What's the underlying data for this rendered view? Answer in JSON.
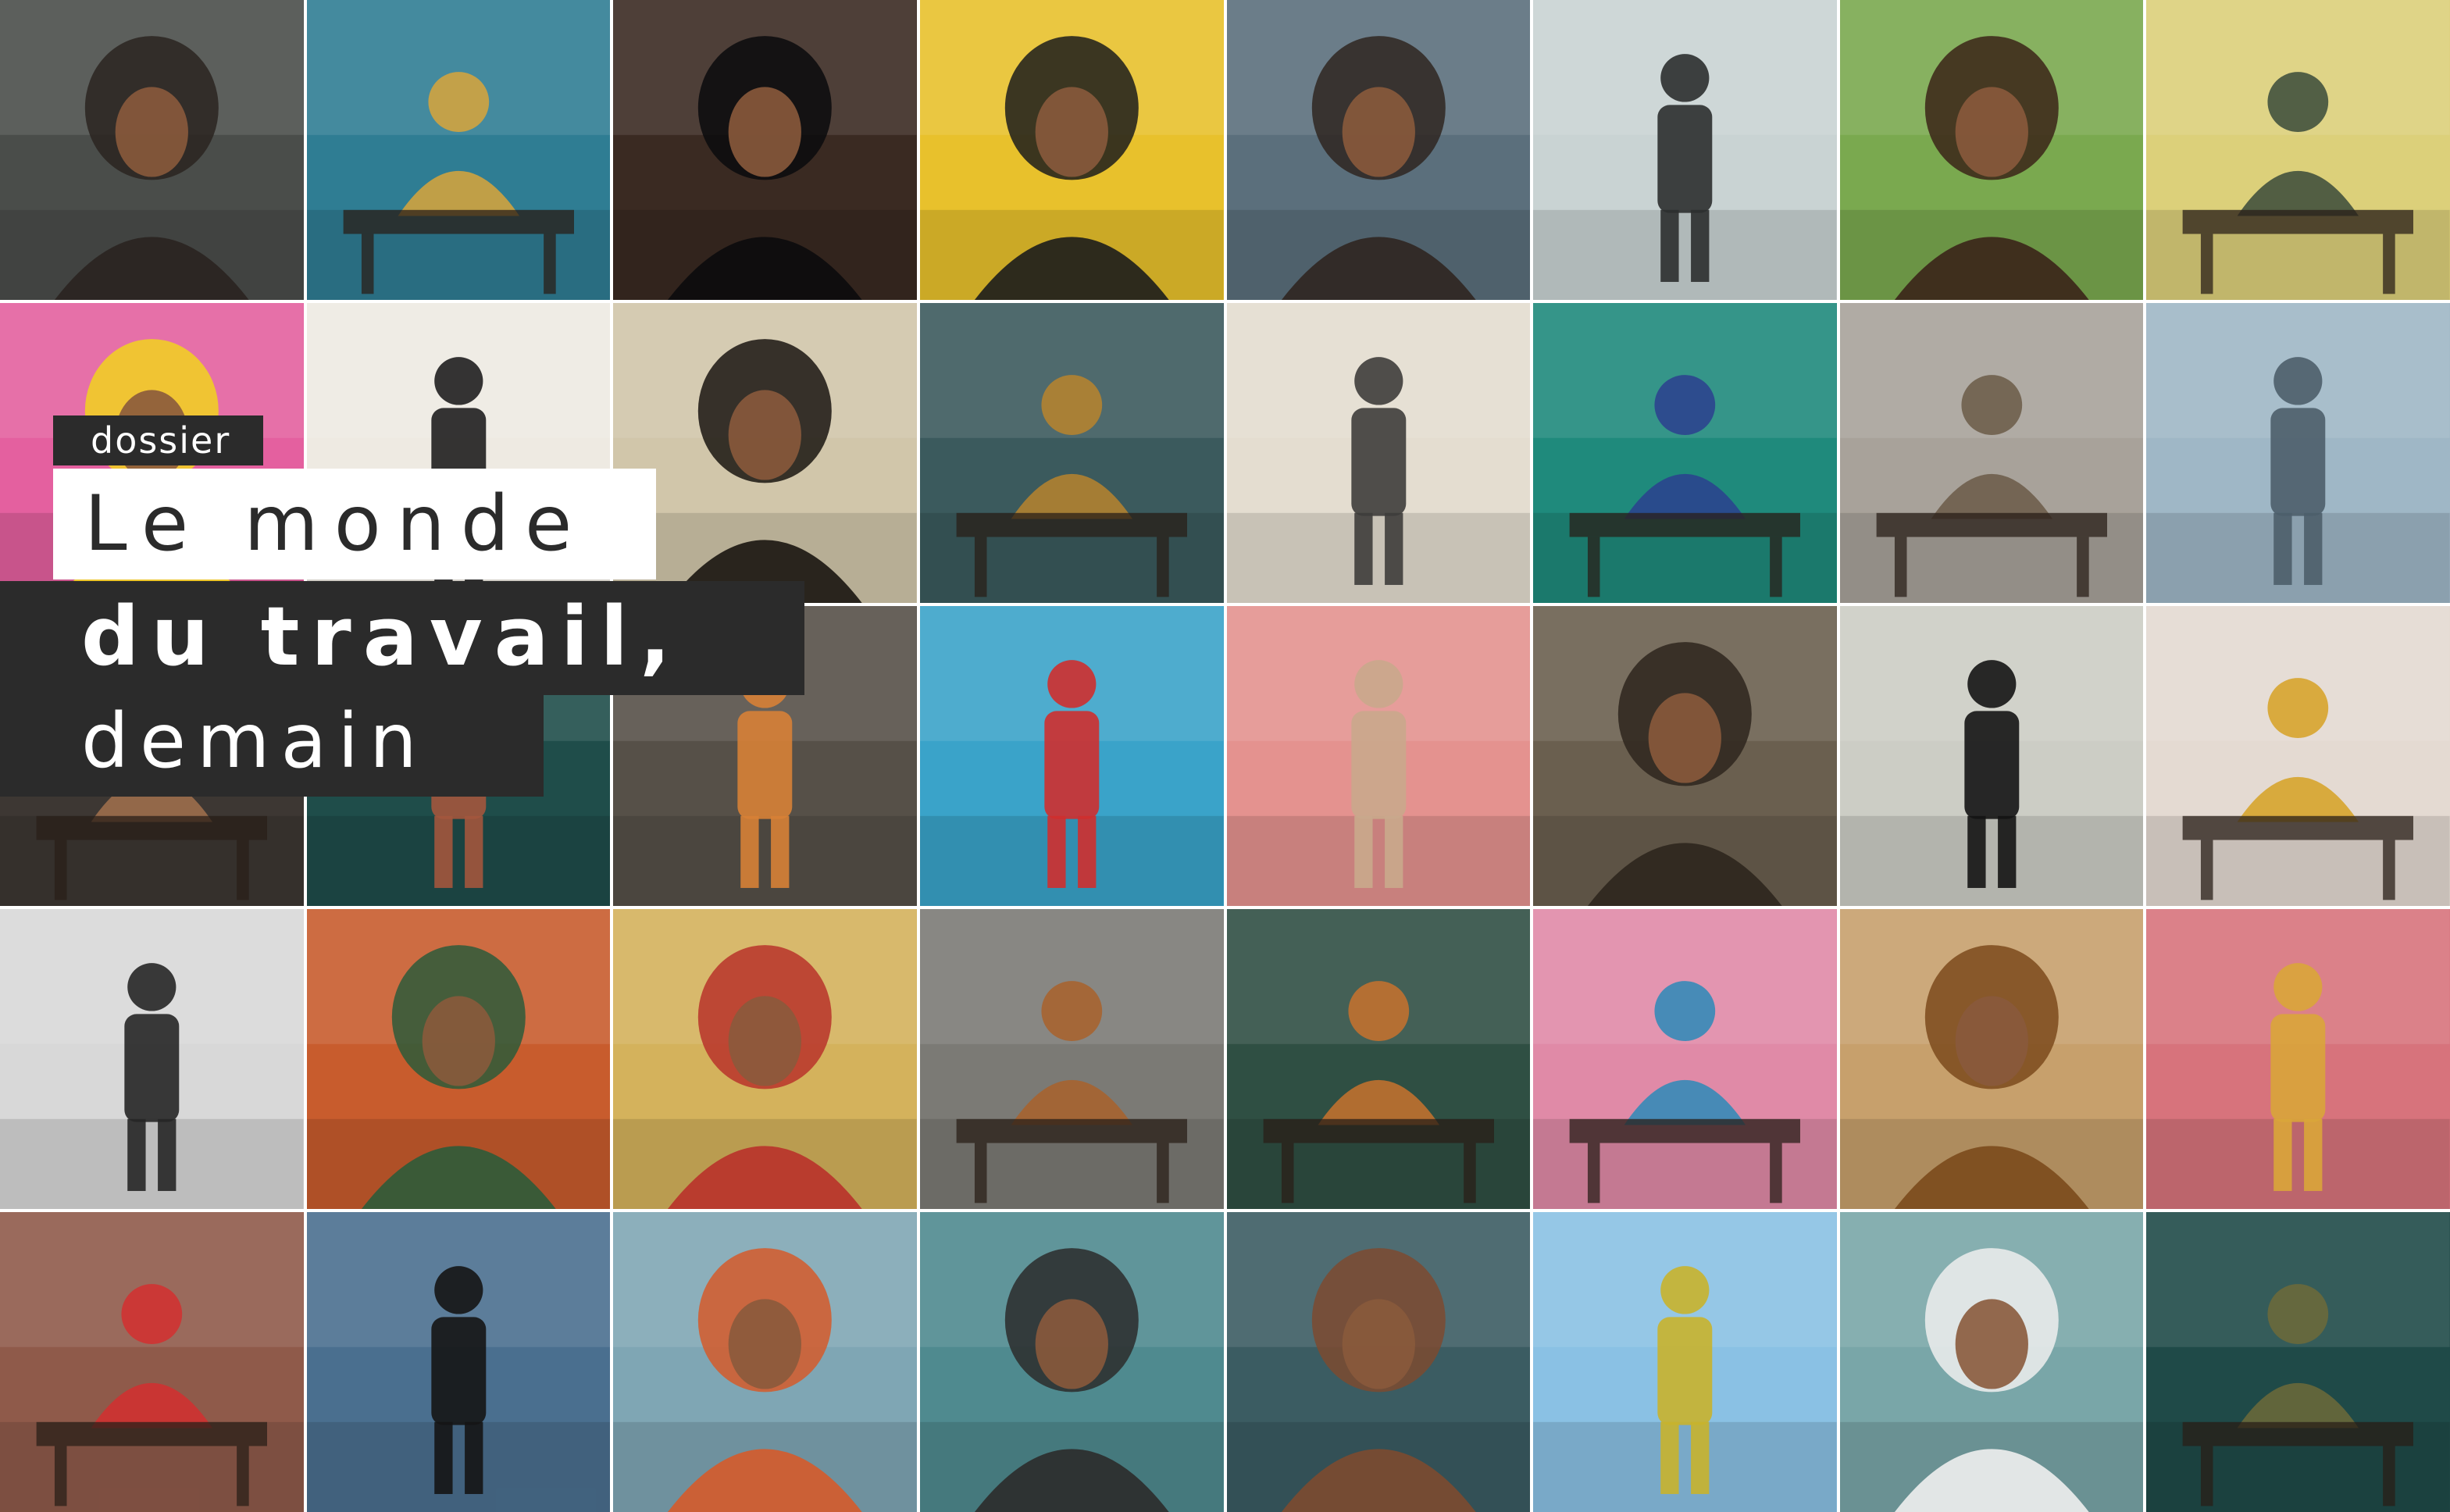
{
  "title_block": {
    "tag": "dossier",
    "line1": "Le monde",
    "line2": "du travail,",
    "line3": "demain"
  },
  "colors": {
    "title_bg": "#2b2b2b",
    "title_text": "#ffffff",
    "title_light_bg": "#ffffff"
  },
  "tiles": [
    {
      "name": "tile-woman-dreadlocks-metal-sculpture",
      "bg": "#4a4d4a",
      "accent": "#2a2420",
      "shape": "portrait"
    },
    {
      "name": "tile-beach-desk-workers",
      "bg": "#2f7d93",
      "accent": "#d9a43a",
      "shape": "desk"
    },
    {
      "name": "tile-woman-curly-hair-computer",
      "bg": "#3a2a22",
      "accent": "#0b0b0d",
      "shape": "portrait"
    },
    {
      "name": "tile-pop-art-woman-collage",
      "bg": "#e8c12c",
      "accent": "#1c1c1c",
      "shape": "portrait"
    },
    {
      "name": "tile-woman-hair-wind-painting",
      "bg": "#5b6f7c",
      "accent": "#2f2621",
      "shape": "portrait"
    },
    {
      "name": "tile-robot-walking-jungle",
      "bg": "#c9d3d3",
      "accent": "#2c2f2f",
      "shape": "figure"
    },
    {
      "name": "tile-woman-vr-goggles-mountains",
      "bg": "#7aa94f",
      "accent": "#3b2418",
      "shape": "portrait"
    },
    {
      "name": "tile-yellow-office-workers-sketch",
      "bg": "#dcd07a",
      "accent": "#3a4a3a",
      "shape": "desk"
    },
    {
      "name": "tile-colorful-collage-man",
      "bg": "#e4609f",
      "accent": "#f1d21f",
      "shape": "portrait"
    },
    {
      "name": "tile-woman-suit-diagram",
      "bg": "#eeeae2",
      "accent": "#1f1f1f",
      "shape": "figure"
    },
    {
      "name": "tile-woman-afro-network-lines",
      "bg": "#d1c6aa",
      "accent": "#1a1510",
      "shape": "portrait"
    },
    {
      "name": "tile-floating-islands-vr-desk",
      "bg": "#3b5a5d",
      "accent": "#b9842d",
      "shape": "desk"
    },
    {
      "name": "tile-woman-seated-collage",
      "bg": "#e4ddd0",
      "accent": "#3e3d3b",
      "shape": "figure"
    },
    {
      "name": "tile-man-typewriter-pop-art",
      "bg": "#1f8a7c",
      "accent": "#2b3f8f",
      "shape": "desk"
    },
    {
      "name": "tile-woman-glasses-desk-writing",
      "bg": "#a8a29a",
      "accent": "#6b5a48",
      "shape": "desk"
    },
    {
      "name": "tile-futuristic-city-office",
      "bg": "#9fb7c6",
      "accent": "#4c5e6a",
      "shape": "figure"
    },
    {
      "name": "tile-hands-table-dark",
      "bg": "#3d3733",
      "accent": "#a2714e",
      "shape": "desk"
    },
    {
      "name": "tile-man-sitting-dark-collage",
      "bg": "#1f4d4a",
      "accent": "#a3573d",
      "shape": "figure"
    },
    {
      "name": "tile-man-orange-sofa",
      "bg": "#565048",
      "accent": "#d78136",
      "shape": "figure"
    },
    {
      "name": "tile-colorful-man-goggles-dunes",
      "bg": "#3aa3c9",
      "accent": "#cf2f2f",
      "shape": "figure"
    },
    {
      "name": "tile-man-pink-tree-head",
      "bg": "#e4928f",
      "accent": "#c9a98c",
      "shape": "figure"
    },
    {
      "name": "tile-woman-headphones-collage",
      "bg": "#6a5f4f",
      "accent": "#2e261d",
      "shape": "portrait"
    },
    {
      "name": "tile-abstract-black-figures",
      "bg": "#cccdc5",
      "accent": "#141414",
      "shape": "figure"
    },
    {
      "name": "tile-woman-yellow-sweater-laptop",
      "bg": "#e4dad2",
      "accent": "#d6a123",
      "shape": "desk"
    },
    {
      "name": "tile-two-suited-figures-sketch",
      "bg": "#d8d8d8",
      "accent": "#262626",
      "shape": "figure"
    },
    {
      "name": "tile-man-flowers-collage",
      "bg": "#c85c2d",
      "accent": "#2d5b3a",
      "shape": "portrait"
    },
    {
      "name": "tile-woman-red-blouse-landscape",
      "bg": "#d4b25c",
      "accent": "#b9322a",
      "shape": "portrait"
    },
    {
      "name": "tile-orangutan-vr-office",
      "bg": "#7b7a75",
      "accent": "#a9622c",
      "shape": "desk"
    },
    {
      "name": "tile-office-green-city-view",
      "bg": "#2f4f43",
      "accent": "#c8722d",
      "shape": "desk"
    },
    {
      "name": "tile-man-laptop-flowers-pop",
      "bg": "#e08aa7",
      "accent": "#2c89b9",
      "shape": "desk"
    },
    {
      "name": "tile-golden-machine-head",
      "bg": "#c7a06c",
      "accent": "#7b4a1c",
      "shape": "portrait"
    },
    {
      "name": "tile-woman-yellow-suit-machines",
      "bg": "#d7737c",
      "accent": "#d9a53a",
      "shape": "figure"
    },
    {
      "name": "tile-woman-curly-laptop-floral",
      "bg": "#8f5a4a",
      "accent": "#d42f2f",
      "shape": "desk"
    },
    {
      "name": "tile-woman-floating-orbs-sky",
      "bg": "#4a6f8f",
      "accent": "#151515",
      "shape": "figure"
    },
    {
      "name": "tile-woman-goggles-mountain",
      "bg": "#7fa6b4",
      "accent": "#d55b2a",
      "shape": "portrait"
    },
    {
      "name": "tile-man-glasses-office-teal",
      "bg": "#4f8a8f",
      "accent": "#2b2b2b",
      "shape": "portrait"
    },
    {
      "name": "tile-woman-face-paint-collage",
      "bg": "#3b5c62",
      "accent": "#7c4a30",
      "shape": "portrait"
    },
    {
      "name": "tile-man-mirror-sphere-field",
      "bg": "#8ac1e4",
      "accent": "#c8b32c",
      "shape": "figure"
    },
    {
      "name": "tile-woman-paper-hat-white",
      "bg": "#79a6a8",
      "accent": "#efefef",
      "shape": "portrait"
    },
    {
      "name": "tile-woman-laptop-jungle",
      "bg": "#1f4a48",
      "accent": "#6d6a3a",
      "shape": "desk"
    }
  ]
}
